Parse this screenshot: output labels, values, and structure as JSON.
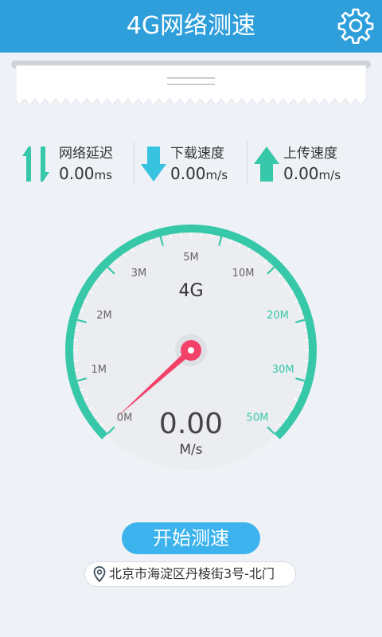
{
  "header": {
    "title": "4G网络测速",
    "settings_icon": "gear-icon"
  },
  "stats": [
    {
      "label": "网络延迟",
      "value": "0.00",
      "unit": "ms",
      "icon": "latency-arrows-icon"
    },
    {
      "label": "下载速度",
      "value": "0.00",
      "unit": "m/s",
      "icon": "download-arrow-icon"
    },
    {
      "label": "上传速度",
      "value": "0.00",
      "unit": "m/s",
      "icon": "upload-arrow-icon"
    }
  ],
  "gauge": {
    "network_type": "4G",
    "value": "0.00",
    "unit": "M/s",
    "ticks": [
      "0M",
      "1M",
      "2M",
      "3M",
      "5M",
      "10M",
      "20M",
      "30M",
      "50M"
    ],
    "needle_level": 0,
    "arc_color": "#36c8a8",
    "needle_color": "#f2426a"
  },
  "actions": {
    "start_label": "开始测速"
  },
  "location": {
    "text": "北京市海淀区丹棱街3号-北门",
    "icon": "location-pin-icon"
  },
  "colors": {
    "header": "#2f9fdb",
    "accent": "#36c8a8",
    "button": "#3cb3ec"
  }
}
